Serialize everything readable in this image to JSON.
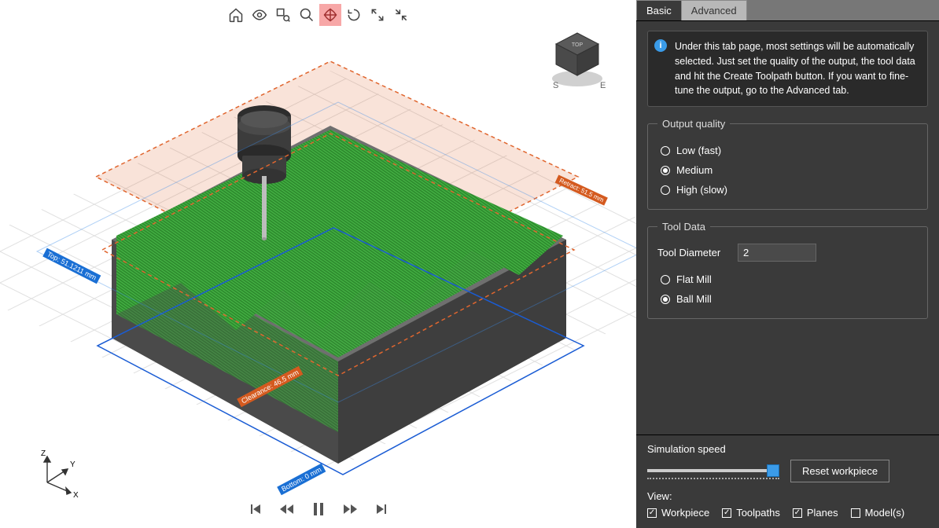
{
  "tabs": {
    "basic": "Basic",
    "advanced": "Advanced",
    "active": "basic"
  },
  "info": "Under this tab page, most settings will be automatically selected. Just set the quality of the output, the tool data and hit the Create Toolpath button. If you want to fine-tune the output, go to the Advanced tab.",
  "output_quality": {
    "legend": "Output quality",
    "options": {
      "low": "Low (fast)",
      "medium": "Medium",
      "high": "High (slow)"
    },
    "selected": "medium"
  },
  "tool_data": {
    "legend": "Tool Data",
    "diameter_label": "Tool Diameter",
    "diameter_value": "2",
    "mill": {
      "flat": "Flat Mill",
      "ball": "Ball Mill"
    },
    "mill_selected": "ball"
  },
  "simulation": {
    "label": "Simulation speed",
    "reset": "Reset workpiece"
  },
  "view": {
    "label": "View:",
    "workpiece": {
      "label": "Workpiece",
      "checked": true
    },
    "toolpaths": {
      "label": "Toolpaths",
      "checked": true
    },
    "planes": {
      "label": "Planes",
      "checked": true
    },
    "models": {
      "label": "Model(s)",
      "checked": false
    }
  },
  "viewcube": {
    "top": "TOP",
    "s": "S",
    "e": "E"
  },
  "axes": {
    "x": "X",
    "y": "Y",
    "z": "Z"
  },
  "planes": {
    "top": "Top:  51.1211 mm",
    "retract": "Retract:  51.5 mm",
    "clearance": "Clearance:  46.5 mm",
    "bottom": "Bottom:  0 mm"
  },
  "toolbar_active": "pan"
}
